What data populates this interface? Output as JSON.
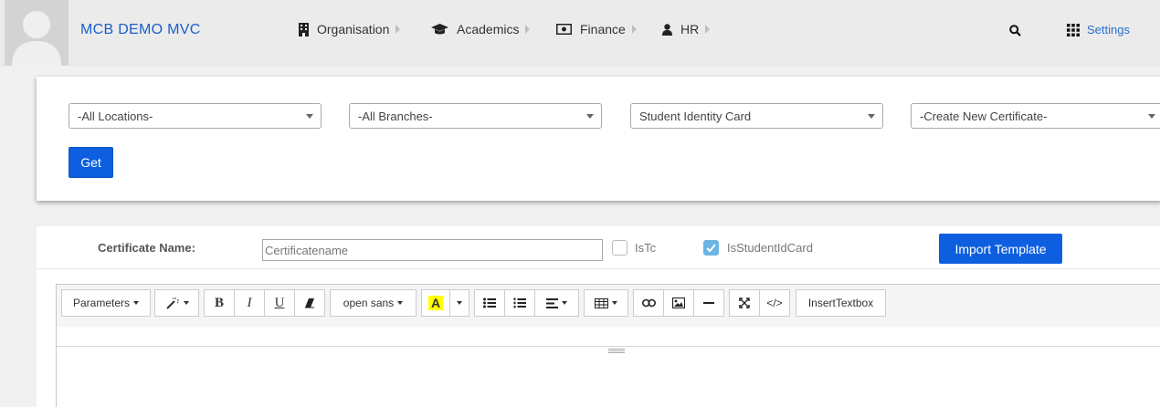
{
  "header": {
    "app_title": "MCB DEMO MVC",
    "nav": [
      {
        "label": "Organisation",
        "icon": "building-icon"
      },
      {
        "label": "Academics",
        "icon": "graduation-cap-icon"
      },
      {
        "label": "Finance",
        "icon": "money-bill-icon"
      },
      {
        "label": "HR",
        "icon": "user-icon"
      }
    ],
    "settings_label": "Settings",
    "search_icon": "search-icon",
    "apps_icon": "grid-icon"
  },
  "filters": {
    "location": "-All Locations-",
    "branch": "-All Branches-",
    "certificate_type": "Student Identity Card",
    "certificate": "-Create New Certificate-",
    "get_label": "Get"
  },
  "certificate_form": {
    "name_label": "Certificate Name:",
    "name_placeholder": "Certificatename",
    "istc_label": "IsTc",
    "istc_checked": false,
    "isstudentidcard_label": "IsStudentIdCard",
    "isstudentidcard_checked": true,
    "import_label": "Import Template"
  },
  "editor_toolbar": {
    "parameters_label": "Parameters",
    "bold": "B",
    "italic": "I",
    "underline": "U",
    "font_name": "open sans",
    "highlight": "A",
    "code": "</>",
    "insert_textbox": "InsertTextbox"
  },
  "colors": {
    "accent": "#0d5fe0",
    "title": "#1a5fc8",
    "topbar": "#ebebeb",
    "checkbox_checked": "#6cb4e4"
  }
}
